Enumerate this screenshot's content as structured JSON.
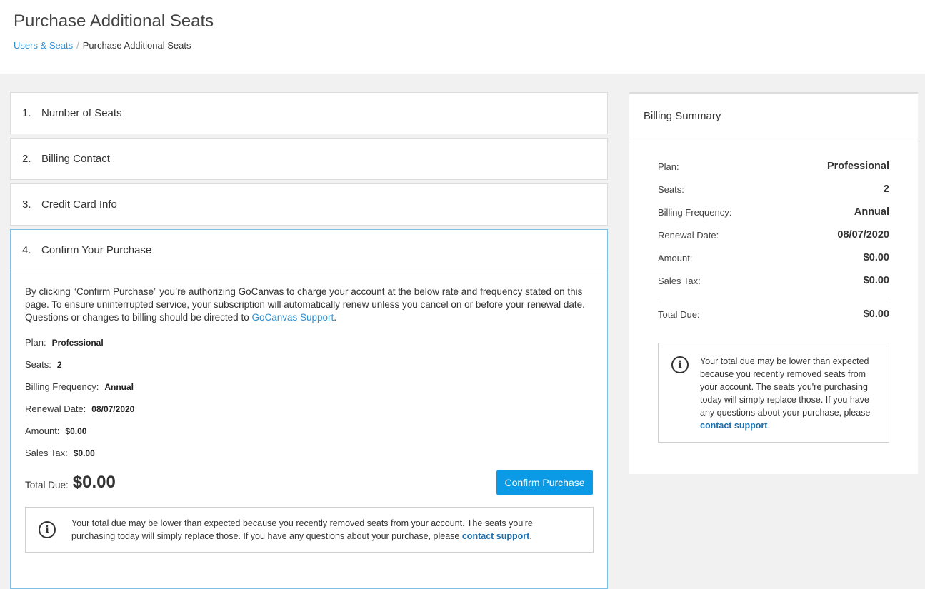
{
  "header": {
    "title": "Purchase Additional Seats",
    "breadcrumb_link": "Users & Seats",
    "breadcrumb_separator": "/",
    "breadcrumb_current": "Purchase Additional Seats"
  },
  "steps": [
    {
      "num": "1.",
      "label": "Number of Seats"
    },
    {
      "num": "2.",
      "label": "Billing Contact"
    },
    {
      "num": "3.",
      "label": "Credit Card Info"
    },
    {
      "num": "4.",
      "label": "Confirm Your Purchase"
    }
  ],
  "confirm": {
    "intro_text": "By clicking “Confirm Purchase” you’re authorizing GoCanvas to charge your account at the below rate and frequency stated on this page. To ensure uninterrupted service, your subscription will automatically renew unless you cancel on or before your renewal date. Questions or changes to billing should be directed to ",
    "intro_link": "GoCanvas Support",
    "intro_end": ".",
    "fields": [
      {
        "label": "Plan:",
        "value": "Professional"
      },
      {
        "label": "Seats:",
        "value": "2"
      },
      {
        "label": "Billing Frequency:",
        "value": "Annual"
      },
      {
        "label": "Renewal Date:",
        "value": "08/07/2020"
      },
      {
        "label": "Amount:",
        "value": "$0.00"
      },
      {
        "label": "Sales Tax:",
        "value": "$0.00"
      }
    ],
    "total_label": "Total Due:",
    "total_value": "$0.00",
    "confirm_button": "Confirm Purchase"
  },
  "notice": {
    "icon": "info-icon",
    "text": "Your total due may be lower than expected because you recently removed seats from your account. The seats you're purchasing today will simply replace those. If you have any questions about your purchase, please ",
    "link": "contact support",
    "end": "."
  },
  "summary": {
    "title": "Billing Summary",
    "rows": [
      {
        "label": "Plan:",
        "value": "Professional"
      },
      {
        "label": "Seats:",
        "value": "2"
      },
      {
        "label": "Billing Frequency:",
        "value": "Annual"
      },
      {
        "label": "Renewal Date:",
        "value": "08/07/2020"
      },
      {
        "label": "Amount:",
        "value": "$0.00"
      },
      {
        "label": "Sales Tax:",
        "value": "$0.00"
      }
    ],
    "total_label": "Total Due:",
    "total_value": "$0.00"
  },
  "colors": {
    "accent": "#0a9ae6",
    "link": "#2f8fd1",
    "page_bg": "#f1f1f1"
  }
}
